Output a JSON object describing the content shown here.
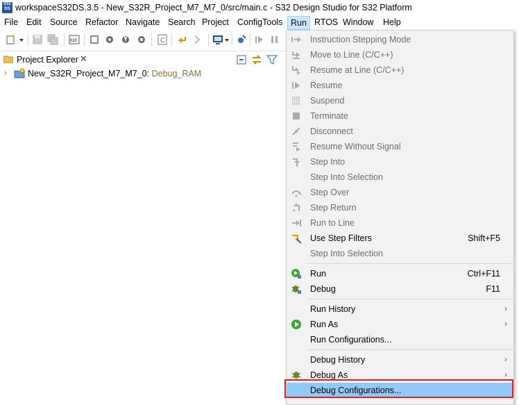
{
  "window": {
    "app_icon_text": "S32\nDS",
    "title": "workspaceS32DS.3.5 - New_S32R_Project_M7_M7_0/src/main.c - S32 Design Studio for S32 Platform"
  },
  "menubar": {
    "items": [
      "File",
      "Edit",
      "Source",
      "Refactor",
      "Navigate",
      "Search",
      "Project",
      "ConfigTools",
      "Run",
      "RTOS",
      "Window",
      "Help"
    ],
    "active": "Run"
  },
  "project_explorer": {
    "tab_label": "Project Explorer",
    "close_glyph": "✕",
    "tree": [
      {
        "name": "New_S32R_Project_M7_M7_0:",
        "decoration": " Debug_RAM"
      }
    ]
  },
  "run_menu": {
    "items": [
      {
        "label": "Instruction Stepping Mode",
        "enabled": false,
        "icon": "instruction-stepping-icon"
      },
      {
        "label": "Move to Line (C/C++)",
        "enabled": false,
        "icon": "move-to-line-icon"
      },
      {
        "label": "Resume at Line (C/C++)",
        "enabled": false,
        "icon": "resume-at-line-icon"
      },
      {
        "label": "Resume",
        "enabled": false,
        "icon": "resume-icon"
      },
      {
        "label": "Suspend",
        "enabled": false,
        "icon": "suspend-icon"
      },
      {
        "label": "Terminate",
        "enabled": false,
        "icon": "terminate-icon"
      },
      {
        "label": "Disconnect",
        "enabled": false,
        "icon": "disconnect-icon"
      },
      {
        "label": "Resume Without Signal",
        "enabled": false,
        "icon": "resume-without-signal-icon"
      },
      {
        "label": "Step Into",
        "enabled": false,
        "icon": "step-into-icon"
      },
      {
        "label": "Step Into Selection",
        "enabled": false,
        "icon": ""
      },
      {
        "label": "Step Over",
        "enabled": false,
        "icon": "step-over-icon"
      },
      {
        "label": "Step Return",
        "enabled": false,
        "icon": "step-return-icon"
      },
      {
        "label": "Run to Line",
        "enabled": false,
        "icon": "run-to-line-icon"
      },
      {
        "label": "Use Step Filters",
        "enabled": true,
        "accel": "Shift+F5",
        "icon": "step-filters-icon"
      },
      {
        "label": "Step Into Selection",
        "enabled": false,
        "icon": ""
      },
      {
        "label": "Run",
        "enabled": true,
        "accel": "Ctrl+F11",
        "icon": "run-icon"
      },
      {
        "label": "Debug",
        "enabled": true,
        "accel": "F11",
        "icon": "debug-icon"
      },
      {
        "label": "Run History",
        "enabled": true,
        "submenu": true,
        "icon": ""
      },
      {
        "label": "Run As",
        "enabled": true,
        "submenu": true,
        "icon": "run-as-icon"
      },
      {
        "label": "Run Configurations...",
        "enabled": true,
        "icon": ""
      },
      {
        "label": "Debug History",
        "enabled": true,
        "submenu": true,
        "icon": ""
      },
      {
        "label": "Debug As",
        "enabled": true,
        "submenu": true,
        "icon": "debug-as-icon"
      },
      {
        "label": "Debug Configurations...",
        "enabled": true,
        "highlighted": true,
        "icon": ""
      }
    ],
    "submenu_glyph": "›"
  },
  "colors": {
    "highlight": "#91c9f7",
    "callout": "#e02020",
    "menu_bg": "#f2f2f2",
    "disabled_text": "#6d6d6d"
  }
}
